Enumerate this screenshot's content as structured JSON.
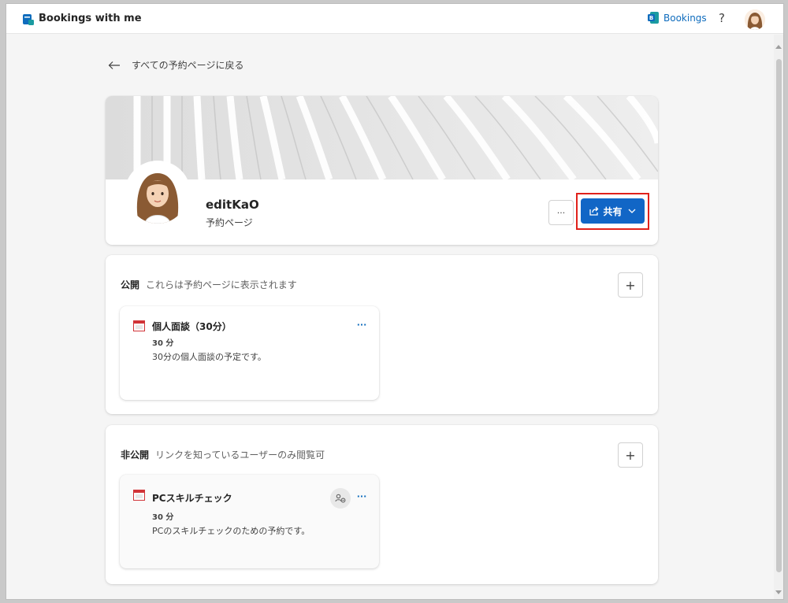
{
  "app": {
    "title": "Bookings with me"
  },
  "topbar": {
    "bookings_link": "Bookings",
    "help": "?"
  },
  "nav": {
    "back_label": "すべての予約ページに戻る"
  },
  "profile": {
    "name": "editKaO",
    "subtitle": "予約ページ",
    "more_label": "···",
    "share_label": "共有"
  },
  "sections": {
    "public": {
      "heading": "公開",
      "description": "これらは予約ページに表示されます",
      "add_label": "+",
      "services": [
        {
          "title": "個人面談（30分）",
          "duration": "30 分",
          "description": "30分の個人面談の予定です。",
          "more_label": "···"
        }
      ]
    },
    "private": {
      "heading": "非公開",
      "description": "リンクを知っているユーザーのみ閲覧可",
      "add_label": "+",
      "services": [
        {
          "title": "PCスキルチェック",
          "duration": "30 分",
          "description": "PCのスキルチェックのための予約です。",
          "more_label": "···"
        }
      ]
    }
  },
  "colors": {
    "accent": "#1166c6",
    "link": "#0f6cbd",
    "highlight_box": "#e0211b"
  },
  "icons": {
    "app": "bookings-app-icon",
    "back": "arrow-left-icon",
    "share": "share-icon",
    "chevron": "chevron-down-icon",
    "service": "calendar-icon",
    "private_badge": "link-people-icon"
  }
}
